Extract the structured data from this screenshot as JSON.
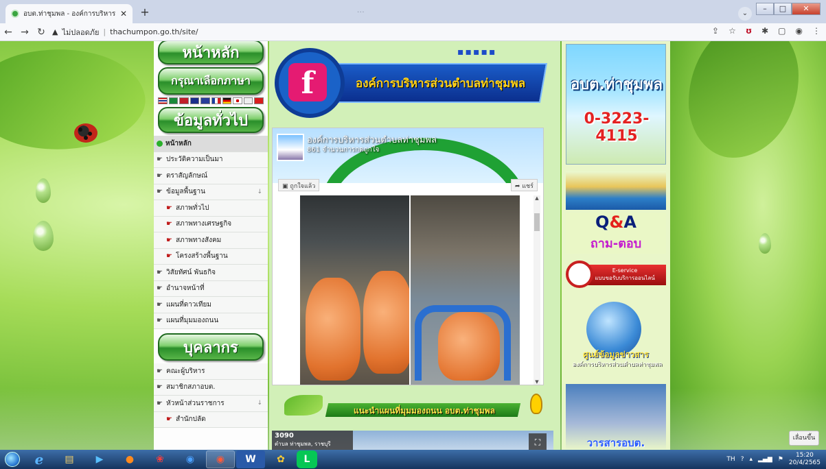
{
  "browser": {
    "tab_title": "อบต.ท่าชุมพล - องค์การบริหารส่วนตำ",
    "tab_close": "✕",
    "new_tab": "+",
    "window_title": "...",
    "url_warning": "ไม่ปลอดภัย",
    "url_separator": "|",
    "url": "thachumpon.go.th/site/",
    "win_min": "–",
    "win_max": "□",
    "win_close": "✕",
    "tab_dropdown": "⌄"
  },
  "left_menu": {
    "home_button": "หน้าหลัก",
    "language_button": "กรุณาเลือกภาษา",
    "general_header": "ข้อมูลทั่วไป",
    "items": [
      {
        "label": "หน้าหลัก"
      },
      {
        "label": "ประวัติความเป็นมา"
      },
      {
        "label": "ตราสัญลักษณ์"
      },
      {
        "label": "ข้อมูลพื้นฐาน"
      },
      {
        "label": "สภาพทั่วไป"
      },
      {
        "label": "สภาพทางเศรษฐกิจ"
      },
      {
        "label": "สภาพทางสังคม"
      },
      {
        "label": "โครงสร้างพื้นฐาน"
      },
      {
        "label": "วิสัยทัศน์ พันธกิจ"
      },
      {
        "label": "อำนาจหน้าที่"
      },
      {
        "label": "แผนที่ดาวเทียม"
      },
      {
        "label": "แผนที่มุมมองถนน"
      }
    ],
    "personnel_header": "บุคลากร",
    "personnel_items": [
      {
        "label": "คณะผู้บริหาร"
      },
      {
        "label": "สมาชิกสภาอบต."
      },
      {
        "label": "หัวหน้าส่วนราชการ"
      },
      {
        "label": "สำนักปลัด"
      }
    ]
  },
  "center": {
    "fb_banner_title": "องค์การบริหารส่วนตำบลท่าชุมพล",
    "fb_banner_dots": "▪▪▪▪▪",
    "fb_logo": "f",
    "fb_page_name": "องค์การบริหารส่วนตำบลท่าชุมพล",
    "fb_page_likes": "861 จำนวนการกดถูกใจ",
    "fb_like_button": "ถูกใจแล้ว",
    "fb_share_button": "แชร์",
    "map_banner_title": "แนะนำแผนที่มุมมองถนน อบต.ท่าชุมพล",
    "map_embed_number": "3090",
    "map_embed_address": "ตำบล ท่าชุมพล, ราชบุรี"
  },
  "right_col": {
    "org_short_name": "อบต.ท่าชุมพล",
    "phone": "0-3223-4115",
    "qa_title_q": "Q",
    "qa_title_amp": "&",
    "qa_title_a": "A",
    "qa_subtitle": "ถาม-ตอบ",
    "eservice_title": "E-service",
    "eservice_sub": "แบบขอรับบริการออนไลน์",
    "info_center": "ศูนย์ข้อมูลข่าวสาร",
    "info_center_sub": "องค์การบริหารส่วนตำบลท่าชุมพล",
    "journal": "วารสารอบต."
  },
  "back_to_top": "เลื่อนขึ้น",
  "taskbar": {
    "lang": "TH",
    "time": "15:20",
    "date": "20/4/2565"
  },
  "colors": {
    "accent_green": "#2a8f2a",
    "fb_blue": "#1a62c8",
    "fb_pink": "#e51b72",
    "phone_red": "#e32222"
  }
}
